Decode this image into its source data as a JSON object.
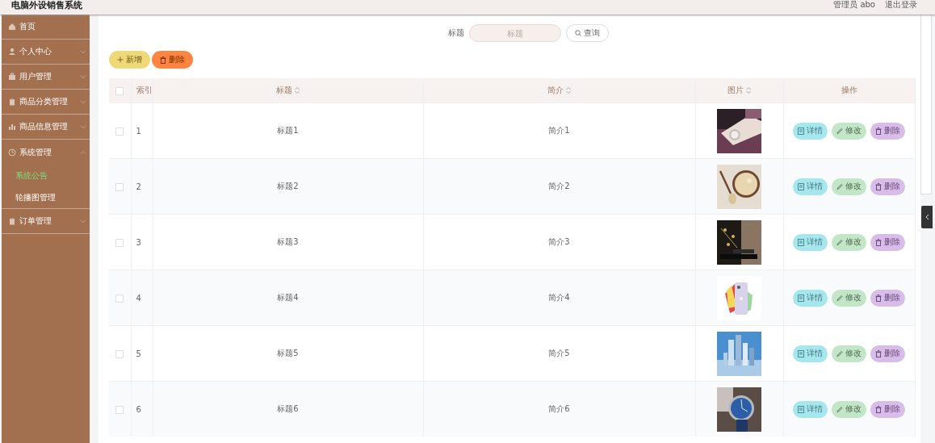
{
  "header": {
    "title": "电脑外设销售系统",
    "user": "管理员 abo",
    "logout": "退出登录"
  },
  "sidebar": {
    "items": [
      {
        "label": "首页",
        "selected": false
      },
      {
        "label": "个人中心",
        "selected": false,
        "expanded": false
      },
      {
        "label": "用户管理",
        "selected": false,
        "expanded": false
      },
      {
        "label": "商品分类管理",
        "selected": false,
        "expanded": false
      },
      {
        "label": "商品信息管理",
        "selected": false,
        "expanded": false
      },
      {
        "label": "系统管理",
        "selected": false,
        "expanded": true,
        "children": [
          {
            "label": "系统公告",
            "selected": true
          },
          {
            "label": "轮播图管理",
            "selected": false
          }
        ]
      },
      {
        "label": "订单管理",
        "selected": false,
        "expanded": false
      }
    ]
  },
  "search": {
    "label": "标题",
    "placeholder": "标题",
    "button": "查询"
  },
  "toolbar": [
    {
      "kind": "add",
      "label": "新增"
    },
    {
      "kind": "delete",
      "label": "删除"
    }
  ],
  "table": {
    "all_checked": false,
    "columns": [
      {
        "label": "索引",
        "sortable": false
      },
      {
        "label": "标题",
        "sortable": true
      },
      {
        "label": "简介",
        "sortable": true
      },
      {
        "label": "图片",
        "sortable": true
      },
      {
        "label": "操作",
        "sortable": false
      }
    ],
    "rows": [
      {
        "checked": false,
        "index": "1",
        "title": "标题1",
        "intro": "简介1",
        "actions": [
          {
            "kind": "detail",
            "label": "详情"
          },
          {
            "kind": "edit",
            "label": "修改"
          },
          {
            "kind": "delete",
            "label": "删除"
          }
        ]
      },
      {
        "checked": false,
        "index": "2",
        "title": "标题2",
        "intro": "简介2",
        "actions": [
          {
            "kind": "detail",
            "label": "详情"
          },
          {
            "kind": "edit",
            "label": "修改"
          },
          {
            "kind": "delete",
            "label": "删除"
          }
        ]
      },
      {
        "checked": false,
        "index": "3",
        "title": "标题3",
        "intro": "简介3",
        "actions": [
          {
            "kind": "detail",
            "label": "详情"
          },
          {
            "kind": "edit",
            "label": "修改"
          },
          {
            "kind": "delete",
            "label": "删除"
          }
        ]
      },
      {
        "checked": false,
        "index": "4",
        "title": "标题4",
        "intro": "简介4",
        "actions": [
          {
            "kind": "detail",
            "label": "详情"
          },
          {
            "kind": "edit",
            "label": "修改"
          },
          {
            "kind": "delete",
            "label": "删除"
          }
        ]
      },
      {
        "checked": false,
        "index": "5",
        "title": "标题5",
        "intro": "简介5",
        "actions": [
          {
            "kind": "detail",
            "label": "详情"
          },
          {
            "kind": "edit",
            "label": "修改"
          },
          {
            "kind": "delete",
            "label": "删除"
          }
        ]
      },
      {
        "checked": false,
        "index": "6",
        "title": "标题6",
        "intro": "简介6",
        "actions": [
          {
            "kind": "detail",
            "label": "详情"
          },
          {
            "kind": "edit",
            "label": "修改"
          },
          {
            "kind": "delete",
            "label": "删除"
          }
        ]
      }
    ]
  }
}
